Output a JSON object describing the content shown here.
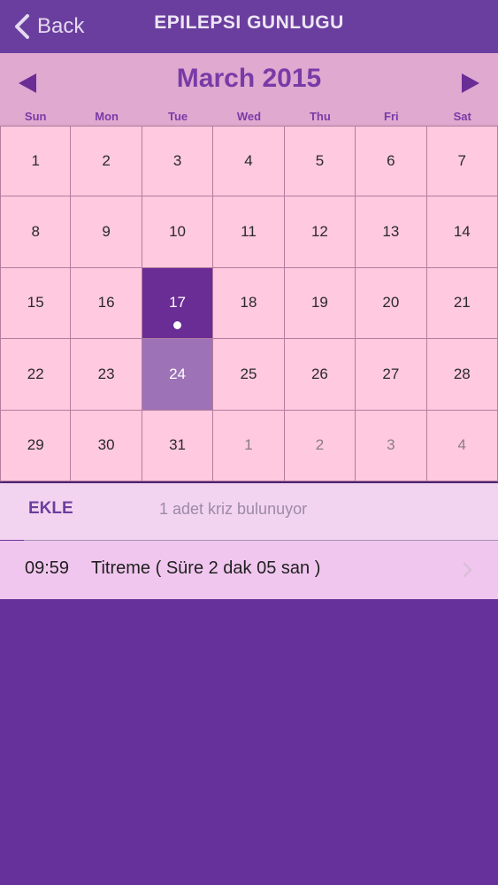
{
  "navbar": {
    "back_label": "Back",
    "title": "EPILEPSI GUNLUGU"
  },
  "calendar": {
    "month_title": "March 2015",
    "weekdays": [
      "Sun",
      "Mon",
      "Tue",
      "Wed",
      "Thu",
      "Fri",
      "Sat"
    ],
    "days": [
      {
        "label": "1",
        "state": "normal"
      },
      {
        "label": "2",
        "state": "normal"
      },
      {
        "label": "3",
        "state": "normal"
      },
      {
        "label": "4",
        "state": "normal"
      },
      {
        "label": "5",
        "state": "normal"
      },
      {
        "label": "6",
        "state": "normal"
      },
      {
        "label": "7",
        "state": "normal"
      },
      {
        "label": "8",
        "state": "normal"
      },
      {
        "label": "9",
        "state": "normal"
      },
      {
        "label": "10",
        "state": "normal"
      },
      {
        "label": "11",
        "state": "normal"
      },
      {
        "label": "12",
        "state": "normal"
      },
      {
        "label": "13",
        "state": "normal"
      },
      {
        "label": "14",
        "state": "normal"
      },
      {
        "label": "15",
        "state": "normal"
      },
      {
        "label": "16",
        "state": "normal"
      },
      {
        "label": "17",
        "state": "selected",
        "has_event": true
      },
      {
        "label": "18",
        "state": "normal"
      },
      {
        "label": "19",
        "state": "normal"
      },
      {
        "label": "20",
        "state": "normal"
      },
      {
        "label": "21",
        "state": "normal"
      },
      {
        "label": "22",
        "state": "normal"
      },
      {
        "label": "23",
        "state": "normal"
      },
      {
        "label": "24",
        "state": "today"
      },
      {
        "label": "25",
        "state": "normal"
      },
      {
        "label": "26",
        "state": "normal"
      },
      {
        "label": "27",
        "state": "normal"
      },
      {
        "label": "28",
        "state": "normal"
      },
      {
        "label": "29",
        "state": "normal"
      },
      {
        "label": "30",
        "state": "normal"
      },
      {
        "label": "31",
        "state": "normal"
      },
      {
        "label": "1",
        "state": "other"
      },
      {
        "label": "2",
        "state": "other"
      },
      {
        "label": "3",
        "state": "other"
      },
      {
        "label": "4",
        "state": "other"
      }
    ]
  },
  "info": {
    "add_label": "EKLE",
    "count_text": "1 adet kriz bulunuyor"
  },
  "entries": [
    {
      "time": "09:59",
      "description": "Titreme ( Süre 2 dak 05 san )"
    }
  ],
  "icons": {
    "back": "chevron-left-icon",
    "prev": "triangle-left-icon",
    "next": "triangle-right-icon",
    "disclosure": "chevron-right-icon"
  },
  "colors": {
    "navbar": "#6a3e9e",
    "background": "#66319a",
    "header": "#dfa9d0",
    "cell": "#ffc9df",
    "selected": "#6a2c95",
    "today": "#9e72b7",
    "accent": "#7a3aa6"
  }
}
